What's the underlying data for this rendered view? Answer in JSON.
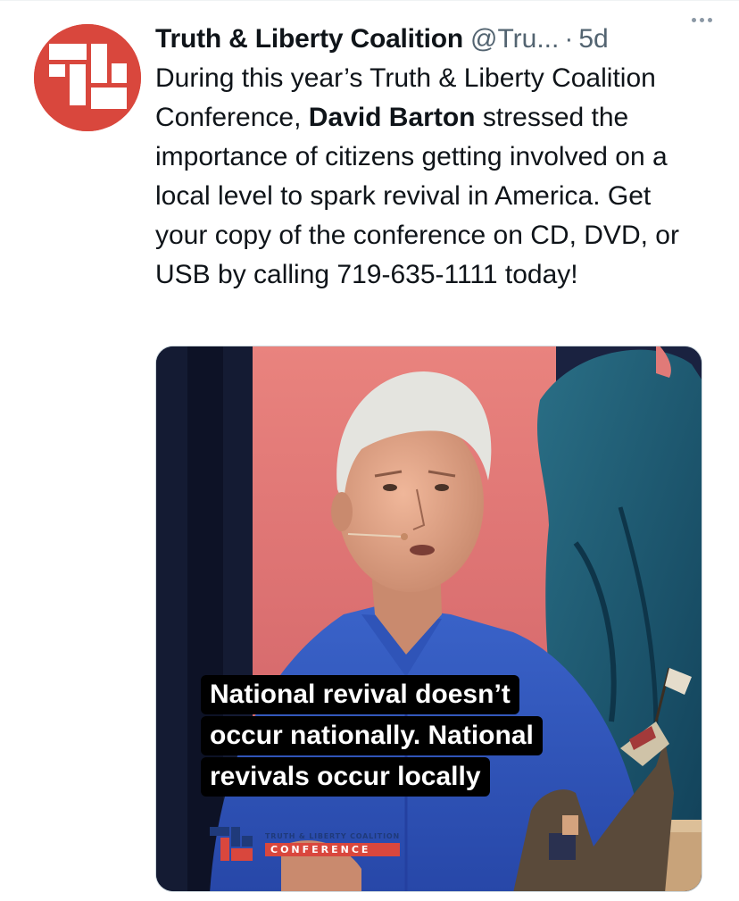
{
  "tweet": {
    "author_name": "Truth & Liberty Coalition",
    "handle": "@Tru...",
    "separator": "·",
    "time": "5d",
    "text_before": "During this year’s Truth & Liberty Coalition Conference, ",
    "text_bold": "David Barton",
    "text_after": " stressed the importance of citizens getting involved on a local level to spark revival in America. Get your copy of the conference on CD, DVD, or USB by calling 719-635-1111 today!"
  },
  "media": {
    "caption_lines": [
      "National revival doesn’t",
      "occur nationally. National",
      "revivals occur locally"
    ],
    "conference_top": "TRUTH & LIBERTY COALITION",
    "conference_bottom": "CONFERENCE"
  },
  "icons": {
    "avatar": "truth-liberty-logo-icon",
    "more": "more-horizontal-icon"
  },
  "colors": {
    "brand_red": "#d9473d",
    "text_primary": "#0f1419",
    "text_secondary": "#536471"
  }
}
